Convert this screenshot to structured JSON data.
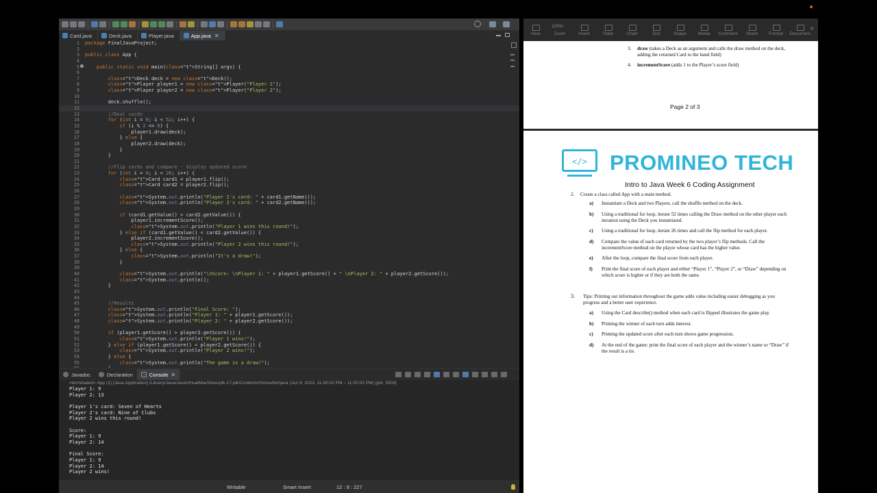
{
  "eclipse": {
    "tabs": [
      {
        "label": "Card.java",
        "active": false
      },
      {
        "label": "Deck.java",
        "active": false
      },
      {
        "label": "Player.java",
        "active": false
      },
      {
        "label": "App.java",
        "active": true
      }
    ],
    "code_lines": [
      "package FinalJavaProject;",
      "",
      "public class App {",
      "",
      "    public static void main(String[] args) {",
      "",
      "        Deck deck = new Deck();",
      "        Player player1 = new Player(\"Player 1\");",
      "        Player player2 = new Player(\"Player 2\");",
      "",
      "        deck.shuffle();",
      "",
      "        //Deal cards",
      "        for (int i = 0; i < 52; i++) {",
      "            if (i % 2 == 0) {",
      "                player1.draw(deck);",
      "            } else {",
      "                player2.draw(deck);",
      "            }",
      "        }",
      "",
      "        //Flip cards and compare - display updated score",
      "        for (int i = 0; i < 26; i++) {",
      "            Card card1 = player1.flip();",
      "            Card card2 = player2.flip();",
      "",
      "            System.out.println(\"Player 1's card: \" + card1.getName());",
      "            System.out.println(\"Player 2's card: \" + card2.getName());",
      "",
      "            if (card1.getValue() > card2.getValue()) {",
      "                player1.incrementScore();",
      "                System.out.println(\"Player 1 wins this round!\");",
      "            } else if (card1.getValue() < card2.getValue()) {",
      "                player2.incrementScore();",
      "                System.out.println(\"Player 2 wins this round!\");",
      "            } else {",
      "                System.out.println(\"It's a draw!\");",
      "            }",
      "",
      "            System.out.println(\"\\nScore: \\nPlayer 1: \" + player1.getScore() + \" \\nPlayer 2: \" + player2.getScore());",
      "            System.out.println();",
      "        }",
      "",
      "",
      "        //Results",
      "        System.out.println(\"Final Score: \");",
      "        System.out.println(\"Player 1: \" + player1.getScore());",
      "        System.out.println(\"Player 2: \" + player2.getScore());",
      "",
      "        if (player1.getScore() > player2.getScore()) {",
      "            System.out.println(\"Player 1 wins!\");",
      "        } else if (player1.getScore() < player2.getScore()) {",
      "            System.out.println(\"Player 2 wins!\");",
      "        } else {",
      "            System.out.println(\"The game is a draw!\");",
      "        }"
    ],
    "console_tabs": [
      {
        "label": "Javadoc",
        "active": false
      },
      {
        "label": "Declaration",
        "active": false
      },
      {
        "label": "Console",
        "active": true
      }
    ],
    "console_path": "<terminated> App (1) [Java Application] /Library/Java/JavaVirtualMachines/jdk-17.jdk/Contents/Home/bin/java  (Jun 9, 2023, 11:00:02 PM – 11:00:02 PM) [pid: 3303]",
    "console_output": [
      "Player 1: 9",
      "Player 2: 13",
      "",
      "Player 1's card: Seven of Hearts",
      "Player 2's card: Nine of Clubs",
      "Player 2 wins this round!",
      "",
      "Score:",
      "Player 1: 9",
      "Player 2: 14",
      "",
      "Final Score:",
      "Player 1: 9",
      "Player 2: 14",
      "Player 2 wins!"
    ],
    "status": {
      "writable": "Writable",
      "insert_mode": "Smart Insert",
      "position": "12 : 9 : 227"
    }
  },
  "pdf": {
    "toolbar": {
      "zoom_value": "125%",
      "items": [
        "View",
        "Zoom",
        "Insert",
        "Table",
        "Chart",
        "Text",
        "Shape",
        "Media",
        "Comment",
        "Share",
        "Format",
        "Document"
      ]
    },
    "page1": {
      "item3_num": "3.",
      "item3_bold": "draw",
      "item3_text": " (takes a Deck as an argument and calls the draw method on the deck,",
      "item3_text2": "adding the returned Card to the hand field)",
      "item4_num": "4.",
      "item4_bold": "incrementScore",
      "item4_text": " (adds 1 to the Player’s score field)",
      "page_label": "Page 2 of 3"
    },
    "page2": {
      "logo_text": "PROMINEO TECH",
      "doc_title": "Intro to Java Week 6 Coding Assignment",
      "item2_num": "2.",
      "item2_text": "Create a class called App with a main method.",
      "sub_items": [
        {
          "letter": "a)",
          "lines": [
            "Instantiate a Deck and two Players, call the shuffle method on the deck."
          ]
        },
        {
          "letter": "b)",
          "lines": [
            "Using a traditional for loop, iterate 52 times calling the Draw method on the other player each",
            "iteration using the Deck you instantiated."
          ]
        },
        {
          "letter": "c)",
          "lines": [
            "Using a traditional for loop, iterate 26 times and call the flip method for each player."
          ]
        },
        {
          "letter": "d)",
          "lines": [
            "Compare the value of each card returned by the two player’s flip methods. Call the",
            "incrementScore method on the player whose card has the higher value."
          ]
        },
        {
          "letter": "e)",
          "lines": [
            "After the loop, compare the final score from each player."
          ]
        },
        {
          "letter": "f)",
          "lines": [
            "Print the final score of each player and either “Player 1”, “Player 2”, or “Draw” depending on",
            "which score is higher or if they are both the same."
          ]
        }
      ],
      "item3_num": "3.",
      "tips_lines": [
        "Tips:  Printing out information throughout the game adds value including easier debugging as you",
        "progress and a better user experience."
      ],
      "tips": [
        {
          "letter": "a)",
          "lines": [
            "Using the Card describe() method when each card is flipped illustrates the game play."
          ]
        },
        {
          "letter": "b)",
          "lines": [
            "Printing the winner of each turn adds interest."
          ]
        },
        {
          "letter": "c)",
          "lines": [
            "Printing the updated score after each turn shows game progression."
          ]
        },
        {
          "letter": "d)",
          "lines": [
            "At the end of the game: print the final score of each player and the winner’s name or “Draw” if",
            "the result is a tie."
          ]
        }
      ]
    }
  },
  "colors": {
    "eclipse_bg": "#2b2b2b",
    "keyword": "#cc7832",
    "string": "#a5c261",
    "comment": "#808080",
    "number": "#6897bb",
    "logo_teal": "#2fb5d9"
  }
}
